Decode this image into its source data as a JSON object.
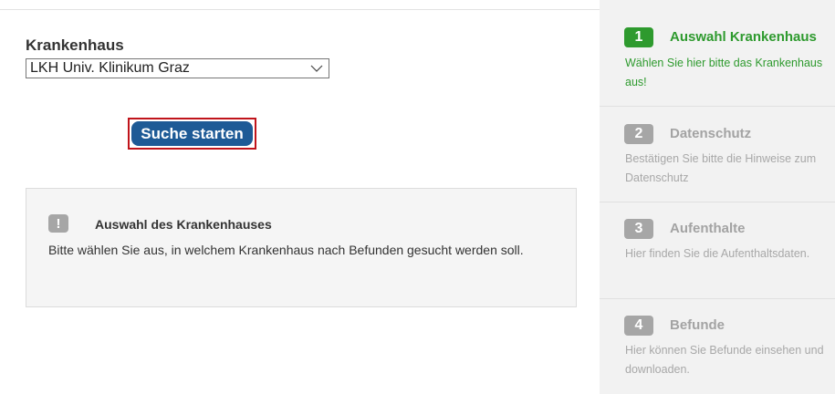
{
  "form": {
    "hospital_label": "Krankenhaus",
    "hospital_selected": "LKH Univ. Klinikum Graz",
    "search_button": "Suche starten"
  },
  "info": {
    "icon_symbol": "!",
    "title": "Auswahl des Krankenhauses",
    "text": "Bitte wählen Sie aus, in welchem Krankenhaus nach Befunden gesucht werden soll."
  },
  "steps": [
    {
      "number": "1",
      "title": "Auswahl Krankenhaus",
      "desc": "Wählen Sie hier bitte das Krankenhaus aus!",
      "state": "active"
    },
    {
      "number": "2",
      "title": "Datenschutz",
      "desc": "Bestätigen Sie bitte die Hinweise zum Datenschutz",
      "state": "inactive"
    },
    {
      "number": "3",
      "title": "Aufenthalte",
      "desc": "Hier finden Sie die Aufenthaltsdaten.",
      "state": "inactive"
    },
    {
      "number": "4",
      "title": "Befunde",
      "desc": "Hier können Sie Befunde einsehen und downloaden.",
      "state": "inactive"
    }
  ],
  "colors": {
    "active_green": "#2e9a2e",
    "inactive_gray": "#a6a6a6",
    "button_blue": "#1d5a96",
    "focus_red": "#c0141b"
  },
  "icons": {
    "select_chevron": "chevron-down-icon",
    "info_marker": "exclamation-icon"
  }
}
